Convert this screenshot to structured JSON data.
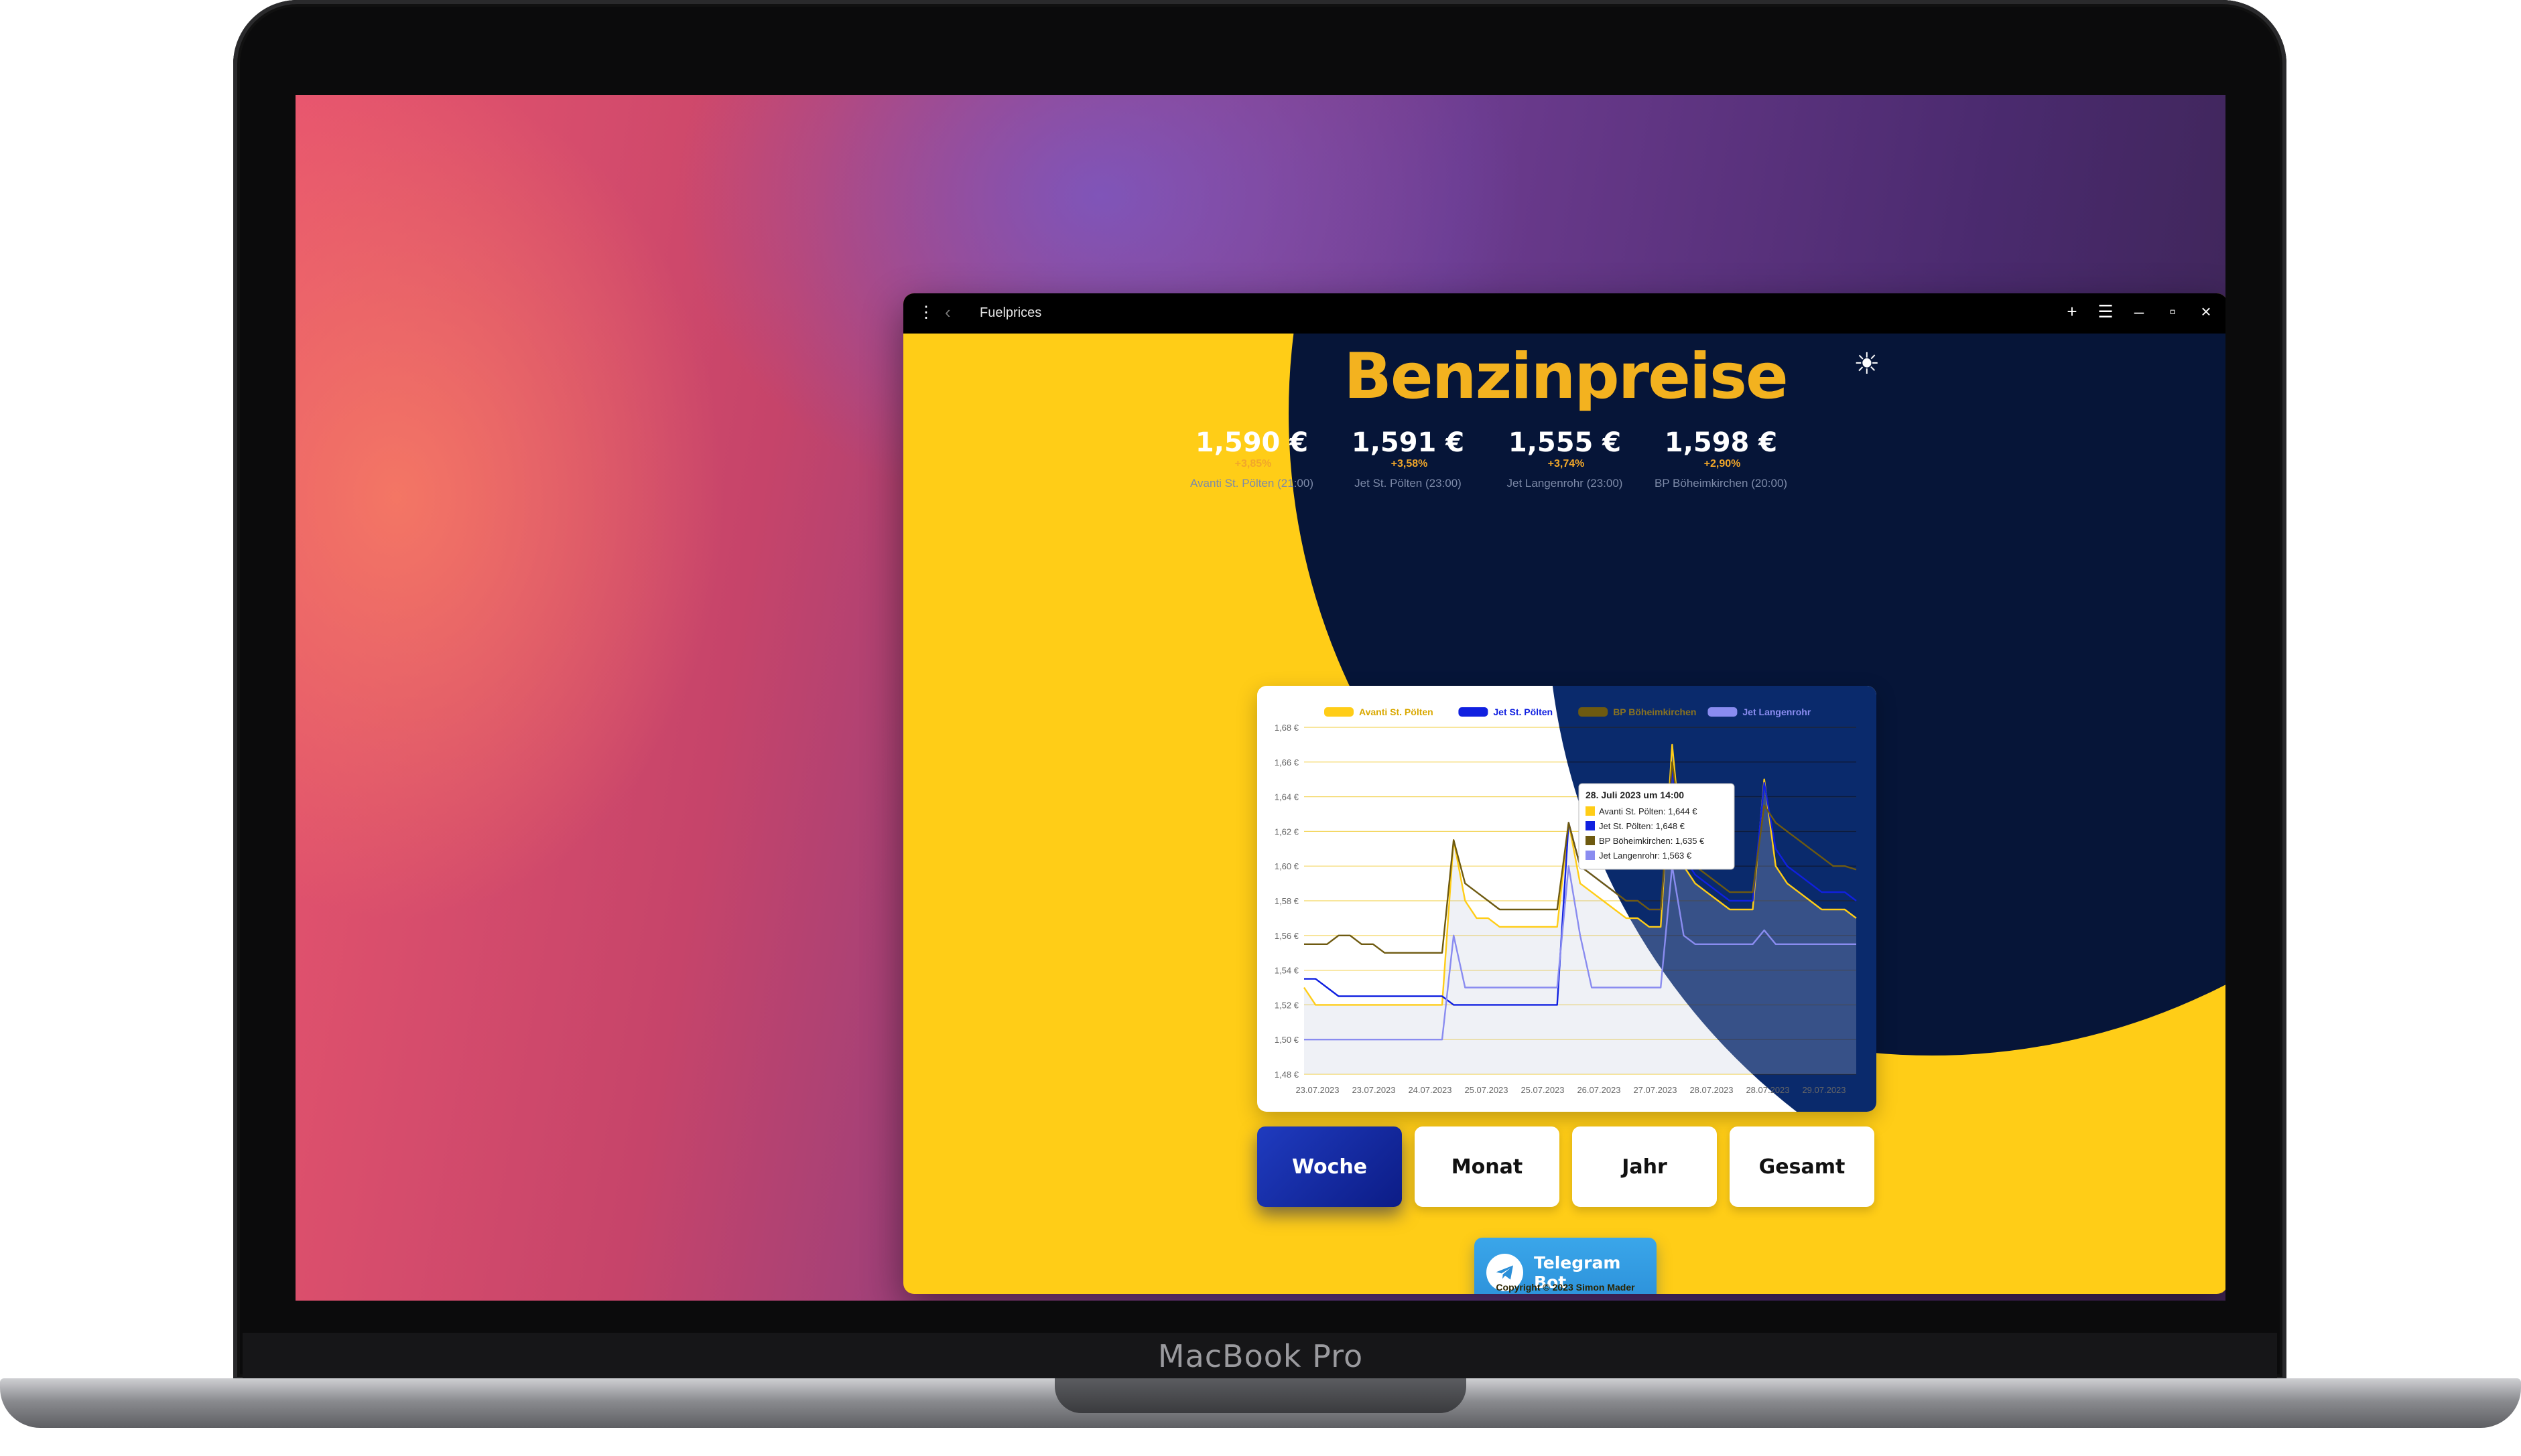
{
  "device": {
    "brand": "MacBook Pro"
  },
  "window": {
    "title": "Fuelprices"
  },
  "app": {
    "title": "Benzinpreise",
    "stations": [
      {
        "price": "1,590 €",
        "change": "+3,85%",
        "label": "Avanti St. Pölten (21:00)"
      },
      {
        "price": "1,591 €",
        "change": "+3,58%",
        "label": "Jet St. Pölten (23:00)"
      },
      {
        "price": "1,555 €",
        "change": "+3,74%",
        "label": "Jet Langenrohr (23:00)"
      },
      {
        "price": "1,598 €",
        "change": "+2,90%",
        "label": "BP Böheimkirchen (20:00)"
      }
    ],
    "periods": [
      "Woche",
      "Monat",
      "Jahr",
      "Gesamt"
    ],
    "active_period": "Woche",
    "telegram_label": "Telegram Bot",
    "footer": "Copyright © 2023 Simon Mader"
  },
  "tooltip": {
    "title": "28. Juli 2023 um 14:00",
    "lines": [
      {
        "text": "Avanti St. Pölten: 1,644 €",
        "color": "#ffcd17"
      },
      {
        "text": "Jet St. Pölten: 1,648 €",
        "color": "#1020e0"
      },
      {
        "text": "BP Böheimkirchen: 1,635 €",
        "color": "#6e5a10"
      },
      {
        "text": "Jet Langenrohr: 1,563 €",
        "color": "#8a8cf0"
      }
    ]
  },
  "chart_data": {
    "type": "line",
    "ylim": [
      1.48,
      1.68
    ],
    "ytick_labels": [
      "1,68 €",
      "1,66 €",
      "1,64 €",
      "1,62 €",
      "1,60 €",
      "1,58 €",
      "1,56 €",
      "1,54 €",
      "1,52 €",
      "1,50 €",
      "1,48 €"
    ],
    "xtick_labels": [
      "23.07.2023",
      "23.07.2023",
      "24.07.2023",
      "25.07.2023",
      "25.07.2023",
      "26.07.2023",
      "27.07.2023",
      "28.07.2023",
      "28.07.2023",
      "29.07.2023"
    ],
    "x": [
      0,
      4,
      8,
      12,
      16,
      20,
      24,
      28,
      32,
      36,
      40,
      44,
      48,
      52,
      56,
      60,
      64,
      68,
      72,
      76,
      80,
      84,
      88,
      92,
      96,
      100,
      104,
      108,
      112,
      116,
      120,
      124,
      128,
      132,
      136,
      140,
      144,
      148,
      152,
      156,
      160,
      164,
      168,
      172,
      176,
      180,
      184,
      188,
      192
    ],
    "series": [
      {
        "name": "Avanti St. Pölten",
        "color": "#ffcd17",
        "values": [
          1.53,
          1.52,
          1.52,
          1.52,
          1.52,
          1.52,
          1.52,
          1.52,
          1.52,
          1.52,
          1.52,
          1.52,
          1.52,
          1.615,
          1.58,
          1.57,
          1.57,
          1.565,
          1.565,
          1.565,
          1.565,
          1.565,
          1.565,
          1.625,
          1.59,
          1.585,
          1.58,
          1.575,
          1.57,
          1.57,
          1.565,
          1.565,
          1.67,
          1.6,
          1.59,
          1.585,
          1.58,
          1.575,
          1.575,
          1.575,
          1.65,
          1.6,
          1.59,
          1.585,
          1.58,
          1.575,
          1.575,
          1.575,
          1.57
        ]
      },
      {
        "name": "Jet St. Pölten",
        "color": "#1020e0",
        "values": [
          1.535,
          1.535,
          1.53,
          1.525,
          1.525,
          1.525,
          1.525,
          1.525,
          1.525,
          1.525,
          1.525,
          1.525,
          1.525,
          1.52,
          1.52,
          1.52,
          1.52,
          1.52,
          1.52,
          1.52,
          1.52,
          1.52,
          1.52,
          1.625,
          1.6,
          1.595,
          1.59,
          1.585,
          1.58,
          1.58,
          1.575,
          1.575,
          1.655,
          1.605,
          1.595,
          1.59,
          1.585,
          1.58,
          1.58,
          1.58,
          1.648,
          1.61,
          1.6,
          1.595,
          1.59,
          1.585,
          1.585,
          1.585,
          1.58
        ]
      },
      {
        "name": "BP Böheimkirchen",
        "color": "#6e5a10",
        "values": [
          1.555,
          1.555,
          1.555,
          1.56,
          1.56,
          1.555,
          1.555,
          1.55,
          1.55,
          1.55,
          1.55,
          1.55,
          1.55,
          1.615,
          1.59,
          1.585,
          1.58,
          1.575,
          1.575,
          1.575,
          1.575,
          1.575,
          1.575,
          1.625,
          1.6,
          1.595,
          1.59,
          1.585,
          1.58,
          1.58,
          1.575,
          1.575,
          1.66,
          1.61,
          1.6,
          1.595,
          1.59,
          1.585,
          1.585,
          1.585,
          1.635,
          1.625,
          1.62,
          1.615,
          1.61,
          1.605,
          1.6,
          1.6,
          1.598
        ]
      },
      {
        "name": "Jet Langenrohr",
        "color": "#8a8cf0",
        "values": [
          1.5,
          1.5,
          1.5,
          1.5,
          1.5,
          1.5,
          1.5,
          1.5,
          1.5,
          1.5,
          1.5,
          1.5,
          1.5,
          1.56,
          1.53,
          1.53,
          1.53,
          1.53,
          1.53,
          1.53,
          1.53,
          1.53,
          1.53,
          1.6,
          1.56,
          1.53,
          1.53,
          1.53,
          1.53,
          1.53,
          1.53,
          1.53,
          1.6,
          1.56,
          1.555,
          1.555,
          1.555,
          1.555,
          1.555,
          1.555,
          1.563,
          1.555,
          1.555,
          1.555,
          1.555,
          1.555,
          1.555,
          1.555,
          1.555
        ]
      }
    ]
  }
}
